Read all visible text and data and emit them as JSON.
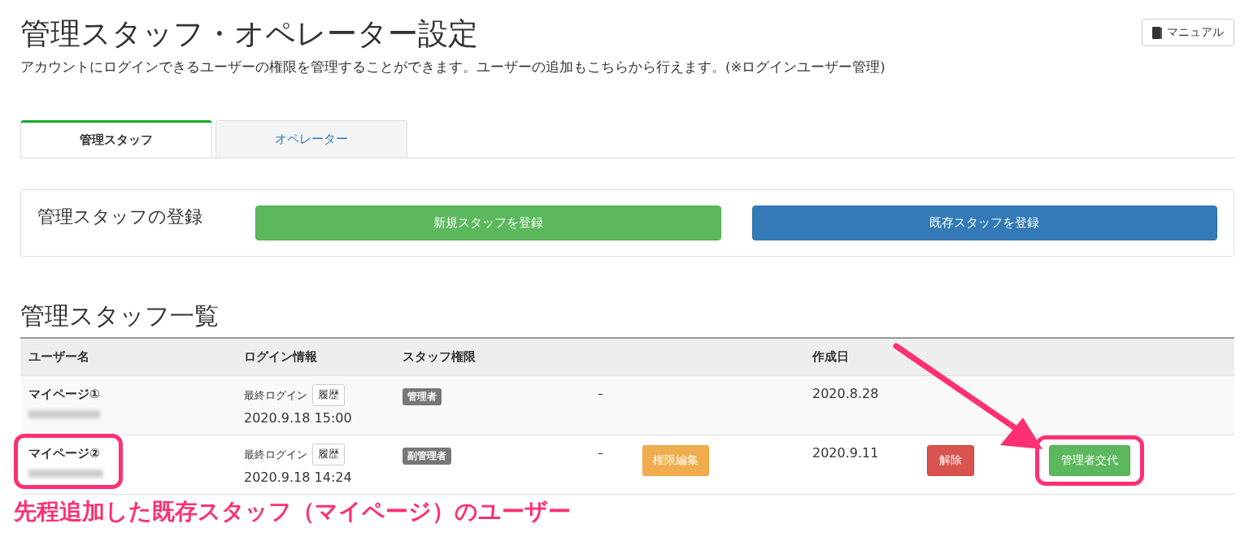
{
  "page": {
    "title": "管理スタッフ・オペレーター設定",
    "description": "アカウントにログインできるユーザーの権限を管理することができます。ユーザーの追加もこちらから行えます。(※ログインユーザー管理)",
    "manual_button": "マニュアル"
  },
  "tabs": [
    {
      "label": "管理スタッフ",
      "selected": true
    },
    {
      "label": "オペレーター",
      "selected": false
    }
  ],
  "register_panel": {
    "label": "管理スタッフの登録",
    "buttons": [
      {
        "label": "新規スタッフを登録",
        "kind": "success"
      },
      {
        "label": "既存スタッフを登録",
        "kind": "primary"
      }
    ]
  },
  "staff_list": {
    "heading": "管理スタッフ一覧",
    "columns": [
      "ユーザー名",
      "ログイン情報",
      "スタッフ権限",
      "作成日"
    ],
    "rows": [
      {
        "name": "マイページ①",
        "login_label": "最終ログイン",
        "history_button": "履歴",
        "last_login": "2020.9.18 15:00",
        "role": "管理者",
        "dash": "–",
        "created": "2020.8.28",
        "highlighted": false
      },
      {
        "name": "マイページ②",
        "login_label": "最終ログイン",
        "history_button": "履歴",
        "last_login": "2020.9.18 14:24",
        "role": "副管理者",
        "dash": "–",
        "edit_button": "権限編集",
        "created": "2020.9.11",
        "delete_button": "解除",
        "transfer_button": "管理者交代",
        "highlighted": true
      }
    ]
  },
  "annotation": {
    "caption": "先程追加した既存スタッフ（マイページ）のユーザー"
  }
}
